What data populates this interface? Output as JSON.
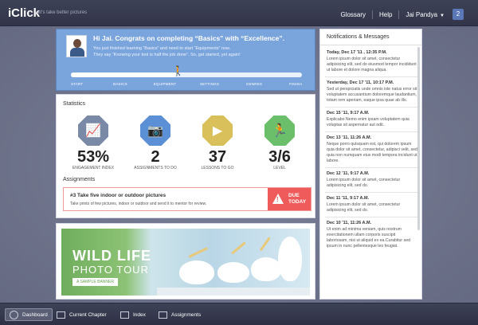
{
  "header": {
    "brand": "iClick",
    "tagline": "Let's take better pictures",
    "nav": [
      "Glossary",
      "Help"
    ],
    "user": "Jai Pandya",
    "badge": "2"
  },
  "hero": {
    "title": "Hi Jai. Congrats on completing “Basics” with “Excellence”.",
    "line1": "You just finished learning “Basics” and need to start “Equipments” now.",
    "line2": "They say “Knowing your tool is half the job done”. So, get started, yet again!",
    "progress": 0.46,
    "steps": [
      "START",
      "BASICS",
      "EQUIPMENT",
      "SETTINGS",
      "GENRES",
      "FINISH"
    ]
  },
  "stats": {
    "title": "Statistics",
    "items": [
      {
        "value": "53%",
        "label": "ENGAGEMENT INDEX",
        "color": "#7a8aa6",
        "icon": "chart-up-icon"
      },
      {
        "value": "2",
        "label": "ASSIGNMENTS TO DO",
        "color": "#5b8fd6",
        "icon": "camera-icon"
      },
      {
        "value": "37",
        "label": "LESSONS TO GO",
        "color": "#d9c05a",
        "icon": "video-icon"
      },
      {
        "value": "3/6",
        "label": "LEVEL",
        "color": "#6cbf6a",
        "icon": "runner-icon"
      }
    ]
  },
  "assignments": {
    "title": "Assignments",
    "item_title": "#3 Take five indoor or outdoor pictures",
    "item_desc": "Take prints of few pictures, indoor or outdoor and send it to mentor for review.",
    "due": "DUE",
    "due_when": "TODAY"
  },
  "banner": {
    "line1": "WILD LIFE",
    "line2": "PHOTO TOUR",
    "line3": "A SAMPLE BANNER"
  },
  "panel": {
    "title": "Notifications & Messages",
    "notes": [
      {
        "date": "Today, Dec 17 '11 , 12:35 P.M.",
        "text": "Lorem ipsum dolor sit amet, consectetur adipisicing elit, sed do eiusmod tempor incididunt ut labore et dolore magna aliqua."
      },
      {
        "date": "Yesterday, Dec 17 '11, 10:17 P.M.",
        "text": "Sed ut perspiciatis unde omnis iste natus error sit voluptatem accusantium doloremque laudantium, totam rem aperiam, eaque ipsa quae ab illo."
      },
      {
        "date": "Dec 15 '11, 9:17 A.M.",
        "text": "Explicabo Nemo enim ipsam voluptatem quia voluptas sit aspernatur aut odit."
      },
      {
        "date": "Dec 13 '11, 11:26 A.M.",
        "text": "Neque porro quisquam est, qui dolorem ipsum quia dolor sit amet, consectetur, adipisci velit, sed quia non numquam eius modi tempora incidunt ut labore."
      },
      {
        "date": "Dec 12 '11, 9:17 A.M.",
        "text": "Lorem ipsum dolor sit amet, consectetur adipisicing elit, sed do."
      },
      {
        "date": "Dec 11 '11, 9:17 A.M.",
        "text": "Lorem ipsum dolor sit amet, consectetur adipisicing elit, sed do."
      },
      {
        "date": "Dec 10 '11, 11:26 A.M.",
        "text": "Ut enim ad minima veniam, quis nostrum exercitationem ullam corporis suscipit laboriosam, nisi ut aliquid ex ea.Curabitur sed ipsum in nunc pellentesque leo feugiat."
      }
    ]
  },
  "bottom": {
    "tabs": [
      "Dashboard",
      "Current Chapter",
      "Index",
      "Assignments"
    ]
  }
}
